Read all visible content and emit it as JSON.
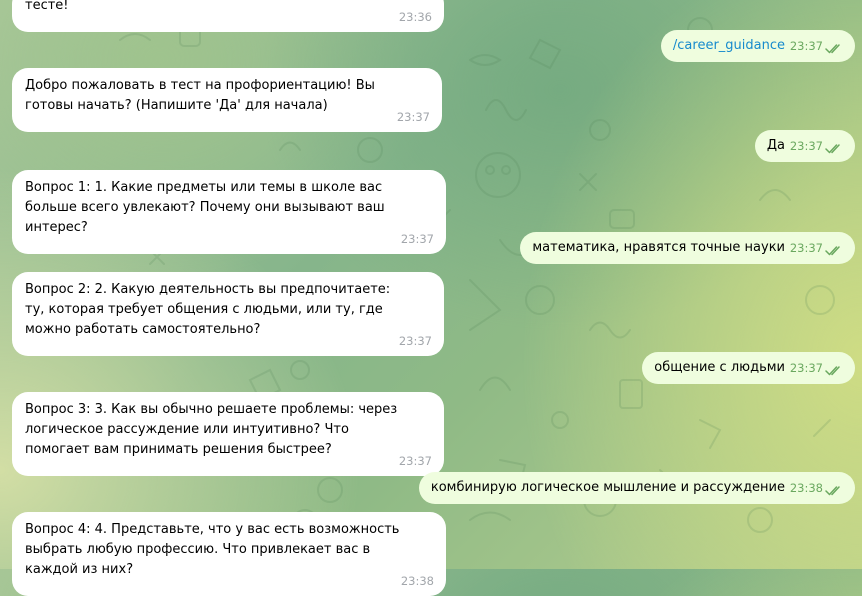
{
  "theme": {
    "incoming_bg": "#ffffff",
    "outgoing_bg": "#effdde",
    "link_color": "#168acd",
    "check_color": "#6aa85f"
  },
  "incoming": [
    {
      "text": "тесте!",
      "time": "23:36"
    },
    {
      "text": "Добро пожаловать в тест на профориентацию! Вы готовы начать? (Напишите 'Да' для начала)",
      "time": "23:37"
    },
    {
      "text": "Вопрос 1: 1. Какие предметы или темы в школе вас больше всего увлекают? Почему они вызывают ваш интерес?",
      "time": "23:37"
    },
    {
      "text": "Вопрос 2: 2. Какую деятельность вы предпочитаете: ту, которая требует общения с людьми, или ту, где можно работать самостоятельно?",
      "time": "23:37"
    },
    {
      "text": "Вопрос 3: 3. Как вы обычно решаете проблемы: через логическое рассуждение или интуитивно? Что помогает вам принимать решения быстрее?",
      "time": "23:37"
    },
    {
      "text": "Вопрос 4: 4. Представьте, что у вас есть возможность выбрать любую профессию. Что привлекает вас в каждой из них?",
      "time": "23:38"
    }
  ],
  "outgoing": [
    {
      "text": "/career_guidance",
      "time": "23:37",
      "status_icon": "double-check-icon"
    },
    {
      "text": "Да",
      "time": "23:37",
      "status_icon": "double-check-icon"
    },
    {
      "text": "математика, нравятся точные науки",
      "time": "23:37",
      "status_icon": "double-check-icon"
    },
    {
      "text": "общение с людьми",
      "time": "23:37",
      "status_icon": "double-check-icon"
    },
    {
      "text": "комбинирую логическое мышление и рассуждение",
      "time": "23:38",
      "status_icon": "double-check-icon"
    }
  ]
}
